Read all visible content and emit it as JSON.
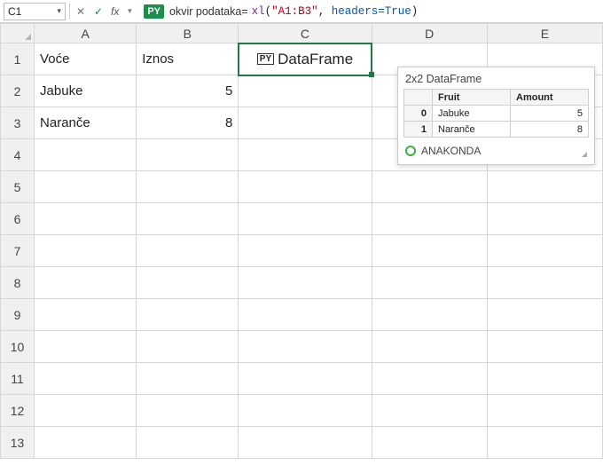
{
  "formula_bar": {
    "name_box": "C1",
    "py_badge": "PY",
    "label": "okvir podataka=",
    "fn": "xl",
    "open": "(",
    "arg_str": "\"A1:B3\"",
    "comma": ", ",
    "kw": "headers=True",
    "close": ")"
  },
  "columns": [
    "A",
    "B",
    "C",
    "D",
    "E"
  ],
  "rows": [
    "1",
    "2",
    "3",
    "4",
    "5",
    "6",
    "7",
    "8",
    "9",
    "10",
    "11",
    "12",
    "13"
  ],
  "cells": {
    "A1": "Voće",
    "B1": "Iznos",
    "A2": "Jabuke",
    "B2": "5",
    "A3": "Naranče",
    "B3": "8"
  },
  "selected": {
    "py_icon": "PY",
    "label": "DataFrame"
  },
  "tooltip": {
    "title": "2x2 DataFrame",
    "headers": [
      "",
      "Fruit",
      "Amount"
    ],
    "rows": [
      {
        "idx": "0",
        "fruit": "Jabuke",
        "amount": "5"
      },
      {
        "idx": "1",
        "fruit": "Naranče",
        "amount": "8"
      }
    ],
    "brand": "ANAKONDA"
  },
  "chart_data": {
    "type": "table",
    "title": "2x2 DataFrame",
    "columns": [
      "Fruit",
      "Amount"
    ],
    "rows": [
      {
        "Fruit": "Jabuke",
        "Amount": 5
      },
      {
        "Fruit": "Naranče",
        "Amount": 8
      }
    ]
  }
}
